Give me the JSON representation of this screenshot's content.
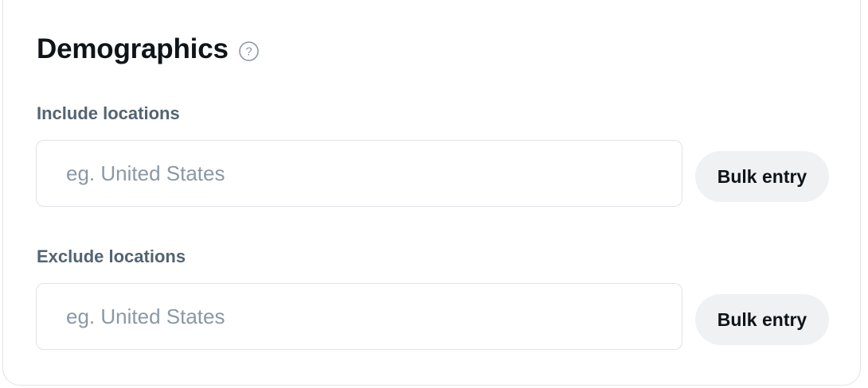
{
  "section": {
    "title": "Demographics",
    "help_icon": "question-circle-icon"
  },
  "include": {
    "label": "Include locations",
    "placeholder": "eg. United States",
    "value": "",
    "bulk_label": "Bulk entry"
  },
  "exclude": {
    "label": "Exclude locations",
    "placeholder": "eg. United States",
    "value": "",
    "bulk_label": "Bulk entry"
  },
  "colors": {
    "title": "#0f1419",
    "label": "#536471",
    "placeholder": "#8b98a5",
    "button_bg": "#eff1f3",
    "border": "#dfe3e6"
  }
}
